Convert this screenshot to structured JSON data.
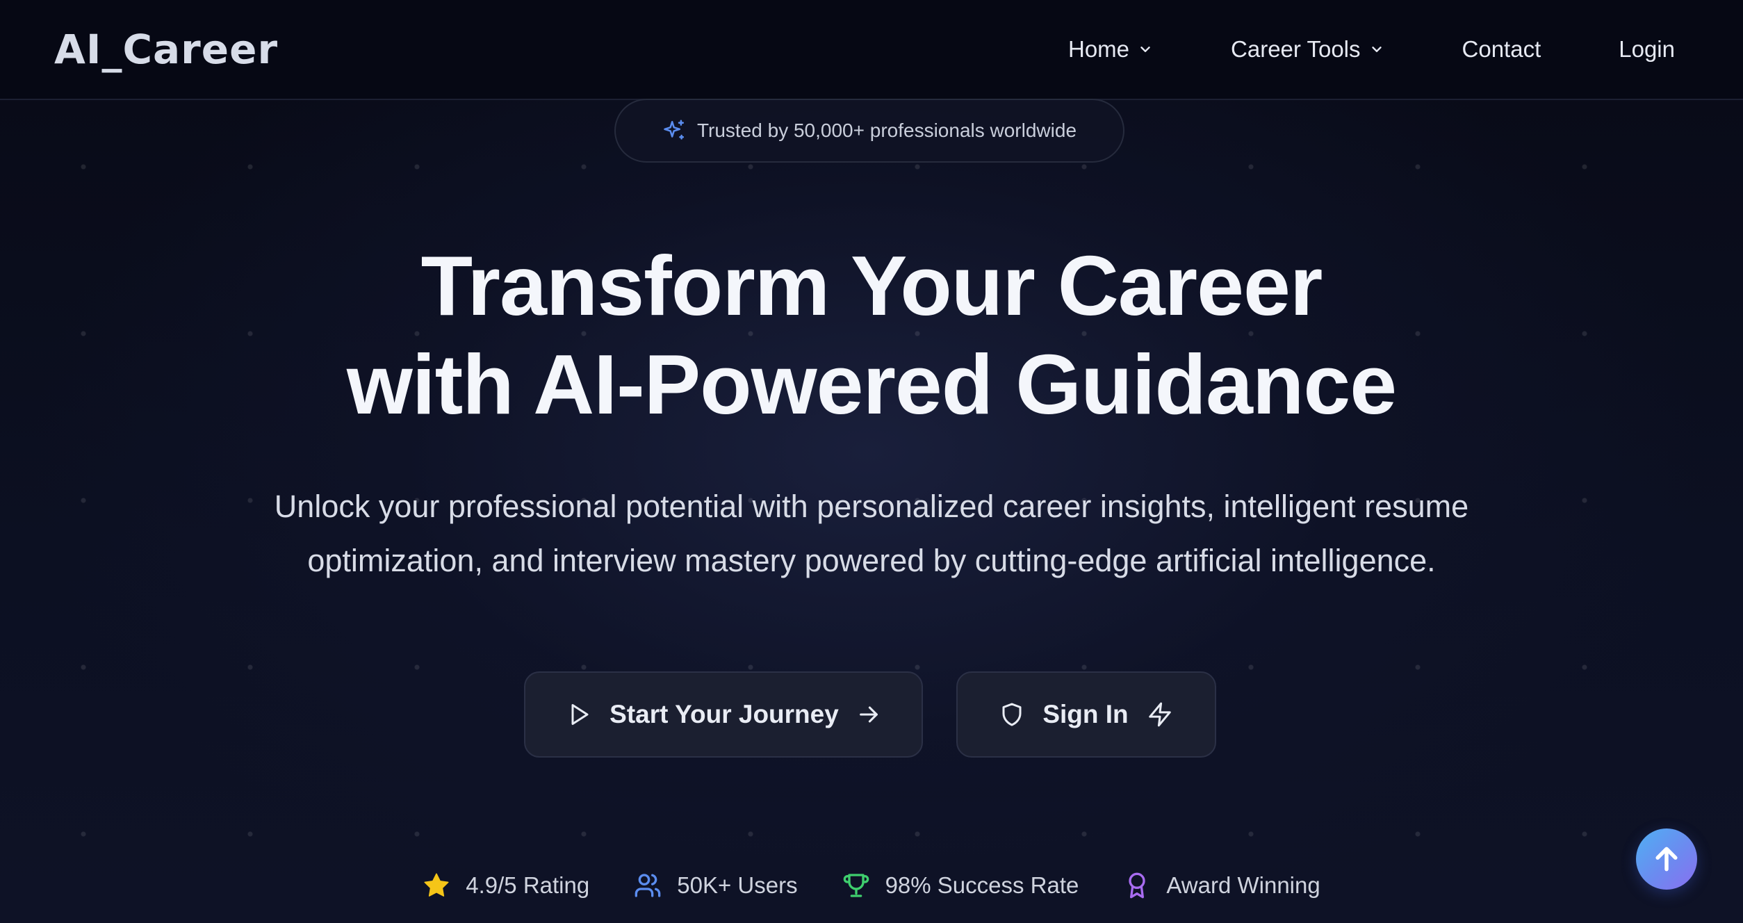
{
  "brand": {
    "logo_text": "AI_Career"
  },
  "nav": {
    "items": [
      {
        "label": "Home",
        "has_dropdown": true
      },
      {
        "label": "Career Tools",
        "has_dropdown": true
      },
      {
        "label": "Contact",
        "has_dropdown": false
      },
      {
        "label": "Login",
        "has_dropdown": false
      }
    ]
  },
  "badge": {
    "icon": "sparkle-icon",
    "text": "Trusted by 50,000+ professionals worldwide"
  },
  "hero": {
    "headline_line1": "Transform Your Career",
    "headline_line2": "with AI-Powered Guidance",
    "subtitle_line1": "Unlock your professional potential with personalized career insights, intelligent resume",
    "subtitle_line2": "optimization, and interview mastery powered by cutting-edge artificial intelligence."
  },
  "buttons": {
    "start": {
      "label": "Start Your Journey",
      "icon_left": "play-icon",
      "icon_right": "arrow-right-icon"
    },
    "signin": {
      "label": "Sign In",
      "icon_left": "shield-icon",
      "icon_right": "lightning-icon"
    }
  },
  "stats": [
    {
      "icon": "star-icon",
      "label": "4.9/5 Rating",
      "color": "#f5c518"
    },
    {
      "icon": "users-icon",
      "label": "50K+ Users",
      "color": "#5b8def"
    },
    {
      "icon": "trophy-icon",
      "label": "98% Success Rate",
      "color": "#3fcf6e"
    },
    {
      "icon": "award-icon",
      "label": "Award Winning",
      "color": "#a86cf0"
    }
  ],
  "scroll_top": {
    "icon": "arrow-up-icon"
  },
  "colors": {
    "background": "#0b0e1d",
    "nav_background": "#060814",
    "badge_icon": "#5b8def",
    "scroll_top_gradient": [
      "#4fb0f3",
      "#8a6ff0"
    ]
  }
}
